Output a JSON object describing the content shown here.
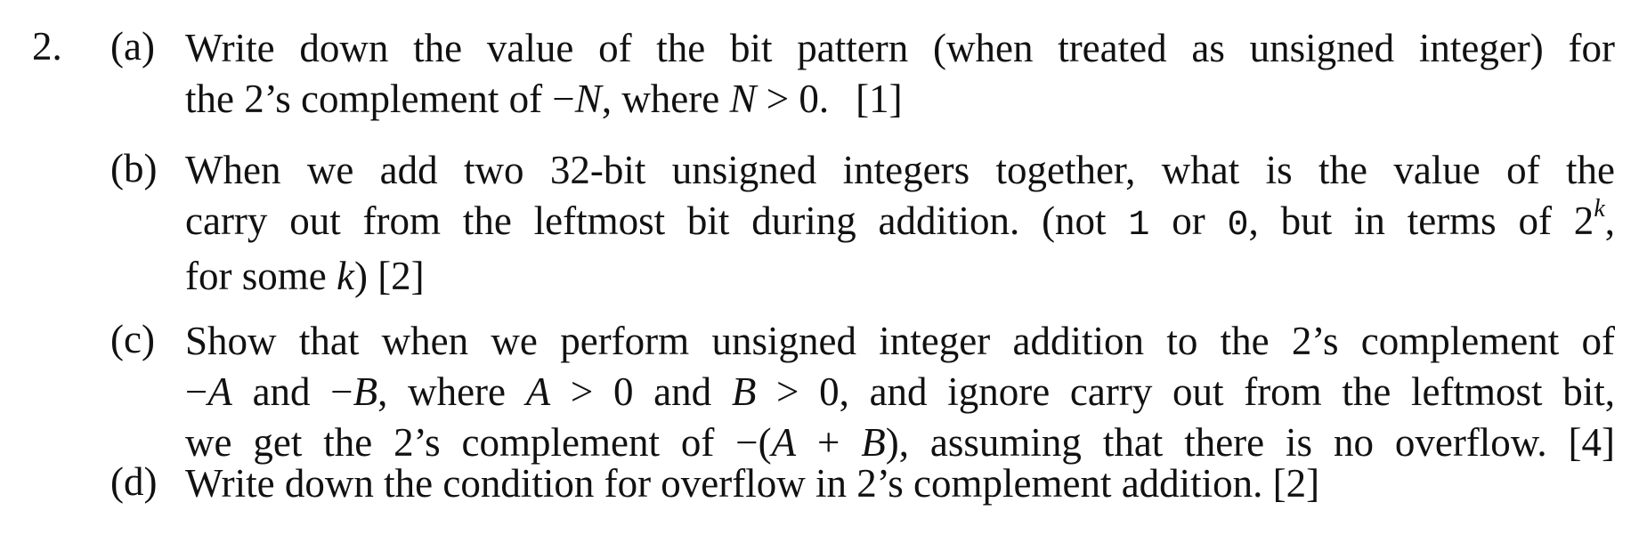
{
  "question": {
    "number": "2.",
    "parts": [
      {
        "label": "(a)",
        "lines": [
          "Write down the value of the bit pattern (when treated as unsigned integer) for",
          "the 2’s complement of −N, where N > 0.",
          "[1]"
        ],
        "marks": "[1]"
      },
      {
        "label": "(b)",
        "line1": "When we add two 32-bit unsigned integers together, what is the value of the",
        "line2_pre": "carry out from the leftmost bit during addition. (not ",
        "code1": "1",
        "line2_mid": " or ",
        "code2": "0",
        "line2_post": ", but in terms of 2",
        "sup": "k",
        "line2_end": ",",
        "line3_pre": "for some ",
        "var": "k",
        "line3_post": ") [2]",
        "marks": "[2]"
      },
      {
        "label": "(c)",
        "line1": "Show that when we perform unsigned integer addition to the 2’s complement of",
        "line2": "−A and −B, where A > 0 and B > 0, and ignore carry out from the leftmost bit,",
        "line3": "we get the 2’s complement of −(A + B), assuming that there is no overflow. [4]",
        "marks": "[4]"
      },
      {
        "label": "(d)",
        "line1": "Write down the condition for overflow in 2’s complement addition. [2]",
        "marks": "[2]"
      }
    ]
  }
}
